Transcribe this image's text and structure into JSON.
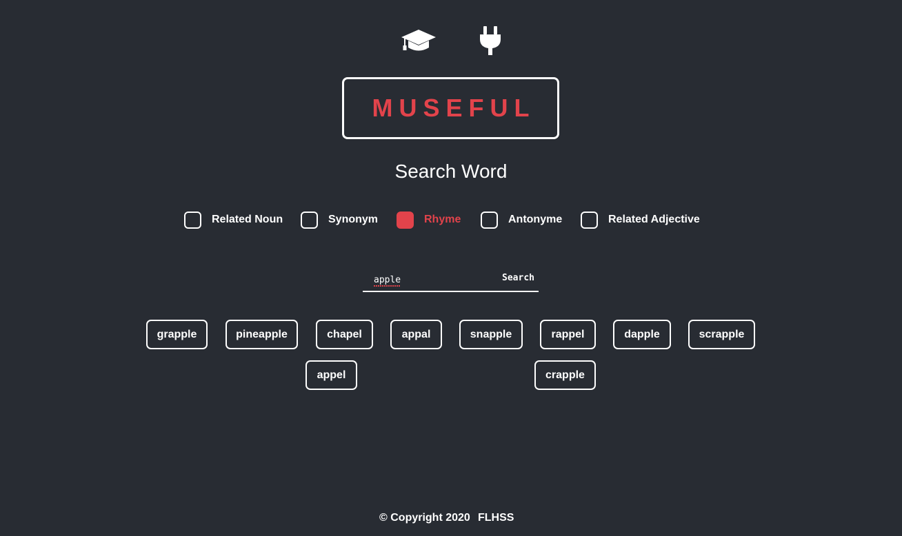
{
  "app": {
    "logo_text": "MUSEFUL"
  },
  "header": {
    "icons": [
      "graduation-cap-icon",
      "plug-icon"
    ]
  },
  "main": {
    "title": "Search Word",
    "options": [
      {
        "label": "Related Noun",
        "checked": false
      },
      {
        "label": "Synonym",
        "checked": false
      },
      {
        "label": "Rhyme",
        "checked": true
      },
      {
        "label": "Antonyme",
        "checked": false
      },
      {
        "label": "Related Adjective",
        "checked": false
      }
    ],
    "search": {
      "value": "apple",
      "button_label": "Search"
    },
    "results": [
      "grapple",
      "pineapple",
      "chapel",
      "appal",
      "snapple",
      "rappel",
      "dapple",
      "scrapple",
      "appel",
      "crapple"
    ]
  },
  "footer": {
    "copyright": "© Copyright 2020",
    "link": "FLHSS"
  },
  "colors": {
    "background": "#282c33",
    "accent": "#e2434b",
    "foreground": "#ffffff"
  }
}
